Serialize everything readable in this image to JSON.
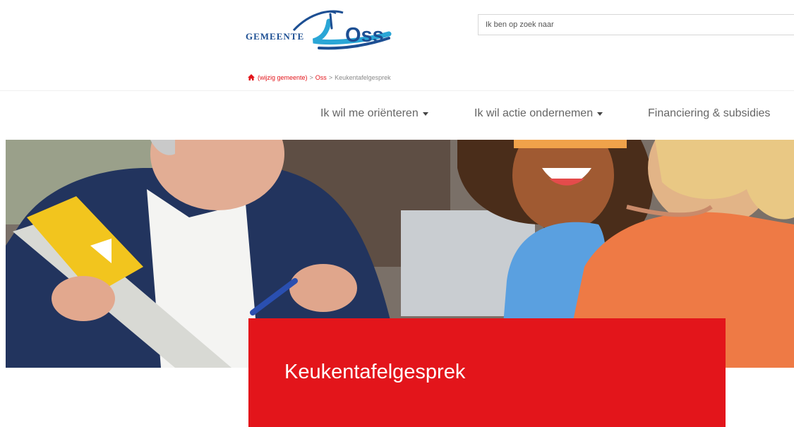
{
  "header": {
    "logo": {
      "label_small": "GEMEENTE",
      "label_big": "Oss"
    },
    "search": {
      "placeholder": "Ik ben op zoek naar"
    }
  },
  "breadcrumb": {
    "items": [
      "(wijzig gemeente)",
      "Oss",
      "Keukentafelgesprek"
    ],
    "separator": ">"
  },
  "nav": {
    "items": [
      {
        "label": "Ik wil me oriënteren",
        "has_dropdown": true
      },
      {
        "label": "Ik wil actie ondernemen",
        "has_dropdown": true
      },
      {
        "label": "Financiering & subsidies",
        "has_dropdown": false
      }
    ]
  },
  "hero": {
    "title": "Keukentafelgesprek"
  },
  "colors": {
    "brand_red": "#e3151b",
    "brand_blue": "#1d4f93",
    "text_grey": "#666666"
  },
  "icons": {
    "home": "home-icon",
    "dropdown": "caret-down-icon"
  }
}
